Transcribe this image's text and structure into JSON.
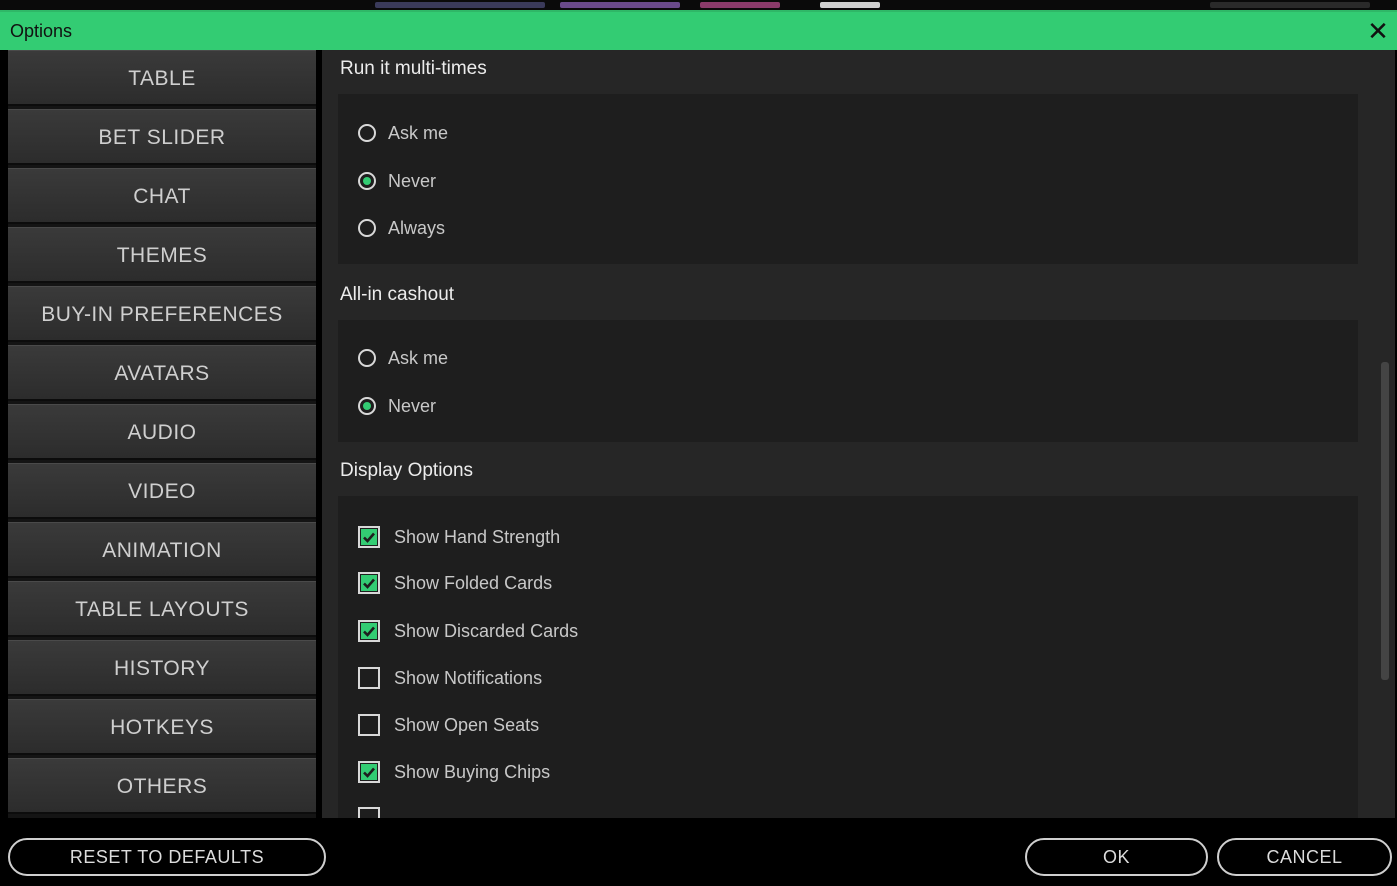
{
  "window": {
    "title": "Options",
    "close_symbol": "✕"
  },
  "sidebar": {
    "items": [
      {
        "label": "TABLE",
        "active": true
      },
      {
        "label": "BET SLIDER",
        "active": false
      },
      {
        "label": "CHAT",
        "active": false
      },
      {
        "label": "THEMES",
        "active": false
      },
      {
        "label": "BUY-IN PREFERENCES",
        "active": false
      },
      {
        "label": "AVATARS",
        "active": false
      },
      {
        "label": "AUDIO",
        "active": false
      },
      {
        "label": "VIDEO",
        "active": false
      },
      {
        "label": "ANIMATION",
        "active": false
      },
      {
        "label": "TABLE LAYOUTS",
        "active": false
      },
      {
        "label": "HISTORY",
        "active": false
      },
      {
        "label": "HOTKEYS",
        "active": false
      },
      {
        "label": "OTHERS",
        "active": false
      }
    ]
  },
  "main": {
    "run_it": {
      "title": "Run it multi-times",
      "options": [
        {
          "label": "Ask me",
          "selected": false
        },
        {
          "label": "Never",
          "selected": true
        },
        {
          "label": "Always",
          "selected": false
        }
      ]
    },
    "cashout": {
      "title": "All-in cashout",
      "options": [
        {
          "label": "Ask me",
          "selected": false
        },
        {
          "label": "Never",
          "selected": true
        }
      ]
    },
    "display": {
      "title": "Display Options",
      "options": [
        {
          "label": "Show Hand Strength",
          "checked": true
        },
        {
          "label": "Show Folded Cards",
          "checked": true
        },
        {
          "label": "Show Discarded Cards",
          "checked": true
        },
        {
          "label": "Show Notifications",
          "checked": false
        },
        {
          "label": "Show Open Seats",
          "checked": false
        },
        {
          "label": "Show Buying Chips",
          "checked": true
        }
      ]
    }
  },
  "footer": {
    "reset_label": "RESET TO DEFAULTS",
    "ok_label": "OK",
    "cancel_label": "CANCEL"
  },
  "colors": {
    "accent": "#33cc73",
    "panel": "#262626",
    "box": "#1e1e1e",
    "nav": "#333333"
  },
  "icons": {
    "close": "close-icon",
    "radio": "radio-icon",
    "checkbox": "checkbox-icon",
    "checkmark": "checkmark-icon"
  }
}
